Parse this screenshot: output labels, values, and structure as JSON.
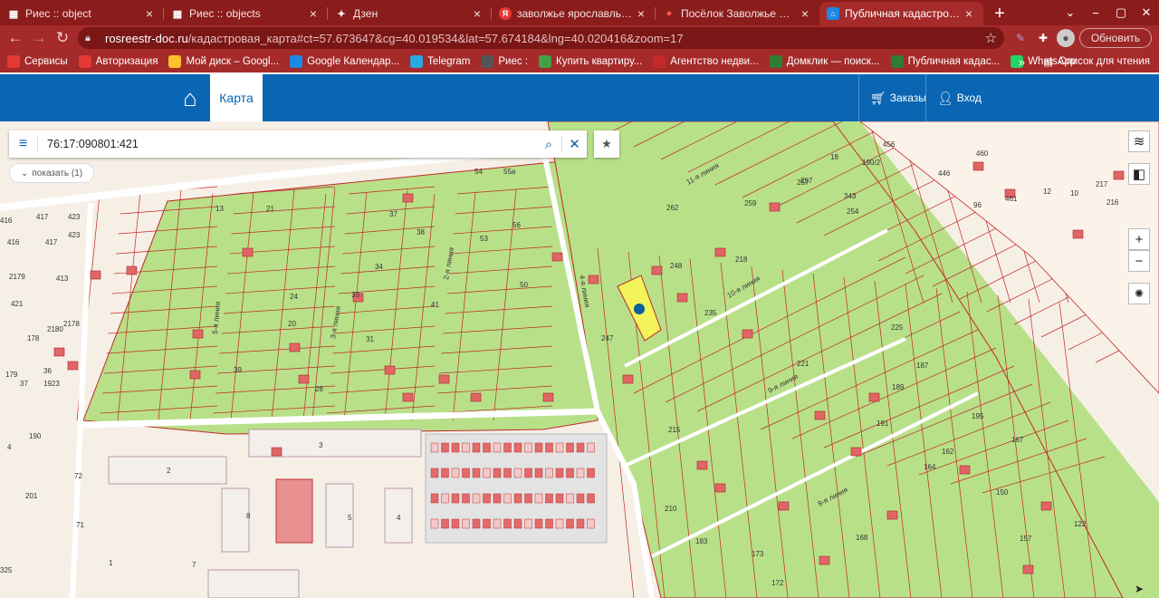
{
  "browser": {
    "tabs": [
      {
        "label": "Риес :: object",
        "icon": "riesgrid-icon"
      },
      {
        "label": "Риес :: objects",
        "icon": "riesgrid-icon"
      },
      {
        "label": "Дзен",
        "icon": "dzen-icon"
      },
      {
        "label": "заволжье ярославль — Янд",
        "icon": "yandex-icon"
      },
      {
        "label": "Посёлок Заволжье — карта",
        "icon": "maps-pin-icon"
      },
      {
        "label": "Публичная кадастровая кар",
        "icon": "home-icon",
        "active": true
      }
    ],
    "url_host": "rosreestr-doc.ru",
    "url_rest": "/кадастровая_карта#ct=57.673647&cg=40.019534&lat=57.674184&lng=40.020416&zoom=17",
    "update_label": "Обновить",
    "bookmarks": [
      {
        "label": "Сервисы",
        "color": "#e53935"
      },
      {
        "label": "Авторизация",
        "color": "#e53935"
      },
      {
        "label": "Мой диск – Googl...",
        "color": "#fbc02d"
      },
      {
        "label": "Google Календар...",
        "color": "#1e88e5"
      },
      {
        "label": "Telegram",
        "color": "#29a9e1"
      },
      {
        "label": "Риес :",
        "color": "#555"
      },
      {
        "label": "Купить квартиру...",
        "color": "#43a047"
      },
      {
        "label": "Агентство недви...",
        "color": "#c62828"
      },
      {
        "label": "Домклик — поиск...",
        "color": "#2e7d32"
      },
      {
        "label": "Публичная кадас...",
        "color": "#2e7d32"
      },
      {
        "label": "WhatsApp",
        "color": "#25d366"
      }
    ],
    "reading_list": "Список для чтения"
  },
  "site": {
    "map_tab": "Карта",
    "orders": "Заказы",
    "login": "Вход"
  },
  "map": {
    "search_value": "76:17:090801:421",
    "show_label": "показать (1)",
    "zoom_in": "+",
    "zoom_out": "−",
    "labels": [
      "456",
      "460",
      "461",
      "446",
      "216",
      "12",
      "10",
      "217",
      "18",
      "190/2",
      "343",
      "254",
      "96",
      "416",
      "417",
      "423",
      "416",
      "417",
      "423",
      "413",
      "2179",
      "2178",
      "421",
      "2180",
      "178",
      "179",
      "1923",
      "36",
      "37",
      "190",
      "4",
      "201",
      "325",
      "72",
      "71",
      "2",
      "3",
      "5",
      "8",
      "4",
      "1",
      "7",
      "55а",
      "54",
      "53",
      "56",
      "50",
      "41",
      "34",
      "37",
      "38",
      "31",
      "33",
      "24",
      "20",
      "21",
      "13",
      "28",
      "39",
      "262",
      "257",
      "259",
      "248",
      "218",
      "225",
      "195",
      "162",
      "164",
      "150",
      "157",
      "183",
      "210",
      "173",
      "215",
      "191",
      "168",
      "187",
      "189",
      "172",
      "122",
      "167",
      "235",
      "221",
      "247",
      "257"
    ],
    "street_labels": [
      "4-я линия",
      "5-я линия",
      "3-я линия",
      "2-я линия",
      "10-я линия",
      "11-я линия",
      "9-я линия",
      "8-я линия"
    ]
  }
}
